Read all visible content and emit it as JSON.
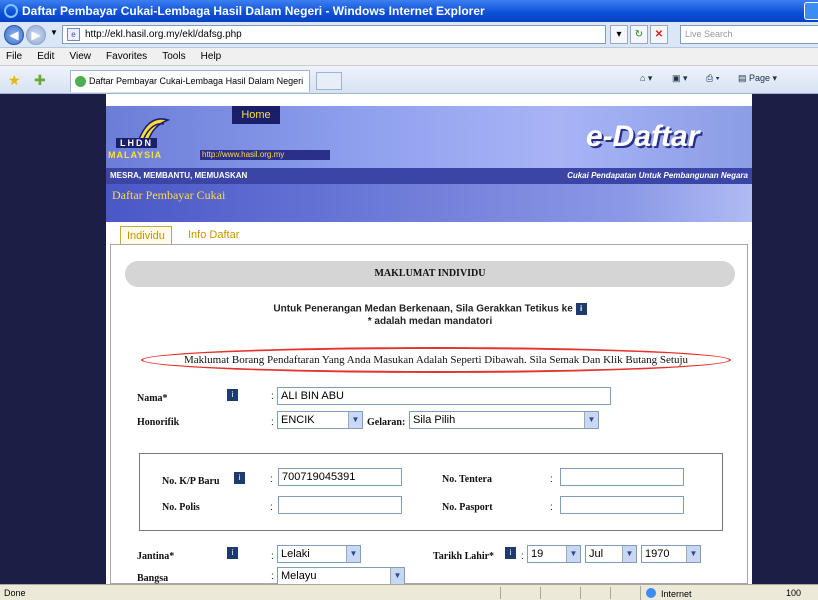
{
  "window": {
    "title": "Daftar Pembayar Cukai-Lembaga Hasil Dalam Negeri - Windows Internet Explorer"
  },
  "address_bar": {
    "url": "http://ekl.hasil.org.my/ekl/dafsg.php",
    "search_placeholder": "Live Search"
  },
  "menu": [
    "File",
    "Edit",
    "View",
    "Favorites",
    "Tools",
    "Help"
  ],
  "tab": {
    "title": "Daftar Pembayar Cukai-Lembaga Hasil Dalam Negeri"
  },
  "command_bar": {
    "page_label": "Page"
  },
  "banner": {
    "home": "Home",
    "lhdn": "LHDN",
    "malaysia": "MALAYSIA",
    "site_url": "http://www.hasil.org.my",
    "app_name": "e-Daftar",
    "motto": "MESRA, MEMBANTU, MEMUASKAN",
    "slogan": "Cukai Pendapatan Untuk Pembangunan Negara"
  },
  "section_bar": {
    "title": "Daftar Pembayar Cukai"
  },
  "page_tabs": [
    "Individu",
    "Info Daftar"
  ],
  "form": {
    "section_title": "MAKLUMAT INDIVIDU",
    "hint_line1": "Untuk Penerangan Medan Berkenaan, Sila Gerakkan Tetikus ke",
    "hint_line2": "* adalah medan mandatori",
    "notice": "Maklumat Borang Pendaftaran Yang Anda Masukan Adalah Seperti Dibawah. Sila Semak Dan Klik Butang Setuju",
    "nama_label": "Nama*",
    "nama_value": "ALI BIN ABU",
    "honorifik_label": "Honorifik",
    "honorifik_value": "ENCIK",
    "gelaran_label": "Gelaran:",
    "gelaran_value": "Sila Pilih",
    "kp_baru_label": "No. K/P Baru",
    "kp_baru_value": "700719045391",
    "tentera_label": "No. Tentera",
    "tentera_value": "",
    "polis_label": "No. Polis",
    "polis_value": "",
    "pasport_label": "No. Pasport",
    "pasport_value": "",
    "jantina_label": "Jantina*",
    "jantina_value": "Lelaki",
    "tarikh_lahir_label": "Tarikh Lahir*",
    "dob_day": "19",
    "dob_month": "Jul",
    "dob_year": "1970",
    "bangsa_label": "Bangsa",
    "bangsa_value": "Melayu",
    "info_icon_glyph": "i"
  },
  "status": {
    "left": "Done",
    "zone": "Internet",
    "zoom": "100"
  }
}
